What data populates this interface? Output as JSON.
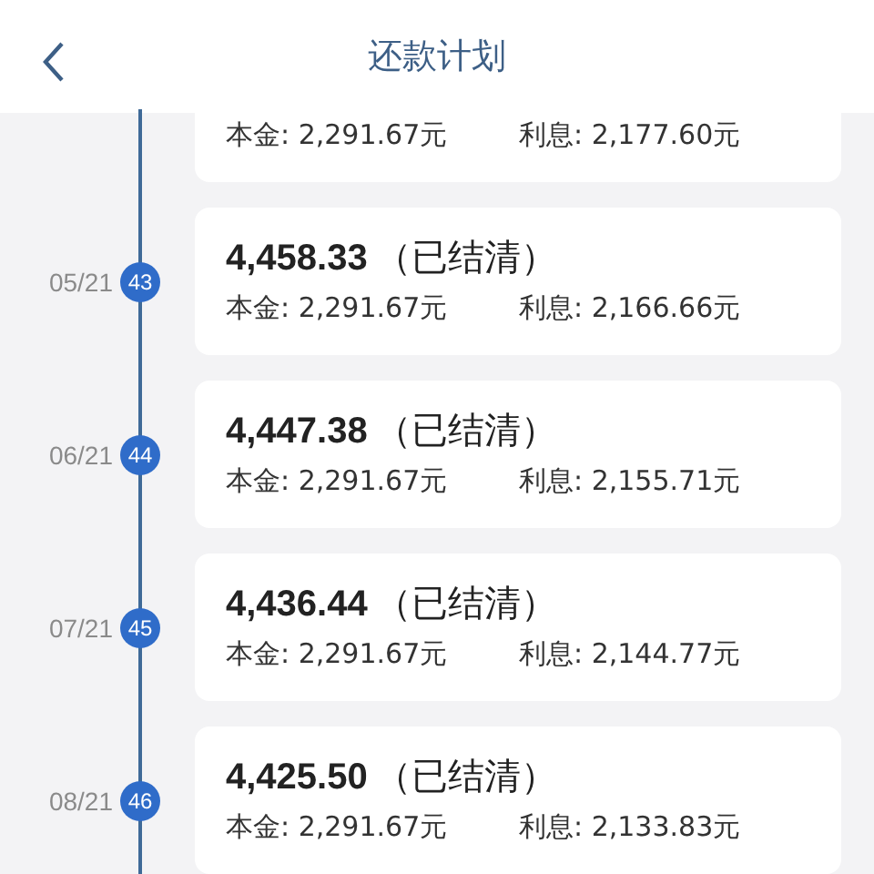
{
  "header": {
    "title": "还款计划"
  },
  "rows": [
    {
      "principal": "本金: 2,291.67元",
      "interest": "利息: 2,177.60元"
    },
    {
      "date": "05/21",
      "period": "43",
      "amount": "4,458.33",
      "status": "（已结清）",
      "principal": "本金: 2,291.67元",
      "interest": "利息: 2,166.66元"
    },
    {
      "date": "06/21",
      "period": "44",
      "amount": "4,447.38",
      "status": "（已结清）",
      "principal": "本金: 2,291.67元",
      "interest": "利息: 2,155.71元"
    },
    {
      "date": "07/21",
      "period": "45",
      "amount": "4,436.44",
      "status": "（已结清）",
      "principal": "本金: 2,291.67元",
      "interest": "利息: 2,144.77元"
    },
    {
      "date": "08/21",
      "period": "46",
      "amount": "4,425.50",
      "status": "（已结清）",
      "principal": "本金: 2,291.67元",
      "interest": "利息: 2,133.83元"
    }
  ]
}
